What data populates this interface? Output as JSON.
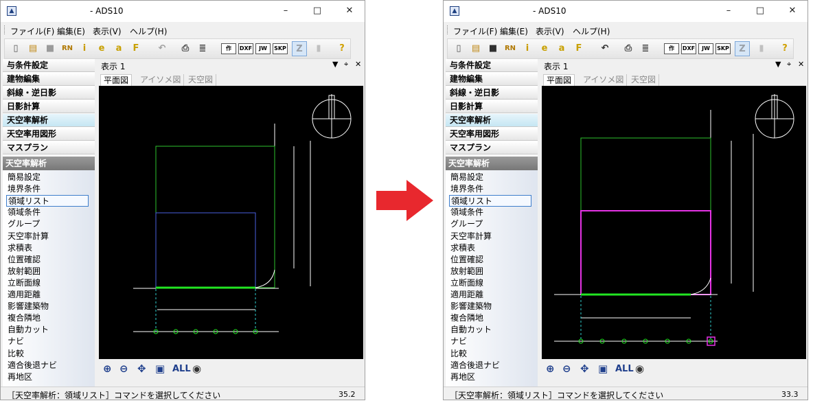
{
  "arrow_color": "#e8282e",
  "windows": [
    {
      "title": "- ADS10",
      "menu": [
        "ファイル(F)",
        "編集(E)",
        "表示(V)",
        "ヘルプ(H)"
      ],
      "toolbar": {
        "rn": "RN",
        "info": "i",
        "e": "e",
        "a": "a",
        "f": "F",
        "saku": "作",
        "dxf": "DXF",
        "jw": "JW",
        "skp": "SKP",
        "z": "Z",
        "help": "?"
      },
      "nav_buttons": [
        "与条件設定",
        "建物編集",
        "斜線・逆日影",
        "日影計算",
        "天空率解析",
        "天空率用図形",
        "マスプラン"
      ],
      "active_nav": "天空率解析",
      "section_title": "天空率解析",
      "list_items": [
        "簡易設定",
        "境界条件",
        "領域リスト",
        "領域条件",
        "グループ",
        "天空率計算",
        "求積表",
        "位置確認",
        "放射範囲",
        "立断面線",
        "適用距離",
        "影響建築物",
        "複合隣地",
        "自動カット",
        "ナビ",
        "比較",
        "適合後退ナビ",
        "再地区"
      ],
      "selected_item": "領域リスト",
      "pane_title": "表示 1",
      "tabs": [
        "平面図",
        "アイソメ図",
        "天空図"
      ],
      "active_tab": "平面図",
      "zoom_all": "ALL",
      "status_message": "［天空率解析：領域リスト］コマンドを選択してください",
      "status_value": "35.2"
    },
    {
      "title": "- ADS10",
      "menu": [
        "ファイル(F)",
        "編集(E)",
        "表示(V)",
        "ヘルプ(H)"
      ],
      "toolbar": {
        "rn": "RN",
        "info": "i",
        "e": "e",
        "a": "a",
        "f": "F",
        "saku": "作",
        "dxf": "DXF",
        "jw": "JW",
        "skp": "SKP",
        "z": "Z",
        "help": "?"
      },
      "nav_buttons": [
        "与条件設定",
        "建物編集",
        "斜線・逆日影",
        "日影計算",
        "天空率解析",
        "天空率用図形",
        "マスプラン"
      ],
      "active_nav": "天空率解析",
      "section_title": "天空率解析",
      "list_items": [
        "簡易設定",
        "境界条件",
        "領域リスト",
        "領域条件",
        "グループ",
        "天空率計算",
        "求積表",
        "位置確認",
        "放射範囲",
        "立断面線",
        "適用距離",
        "影響建築物",
        "複合隣地",
        "自動カット",
        "ナビ",
        "比較",
        "適合後退ナビ",
        "再地区"
      ],
      "selected_item": "領域リスト",
      "pane_title": "表示 1",
      "tabs": [
        "平面図",
        "アイソメ図",
        "天空図"
      ],
      "active_tab": "平面図",
      "zoom_all": "ALL",
      "status_message": "［天空率解析：領域リスト］コマンドを選択してください",
      "status_value": "33.3"
    }
  ]
}
